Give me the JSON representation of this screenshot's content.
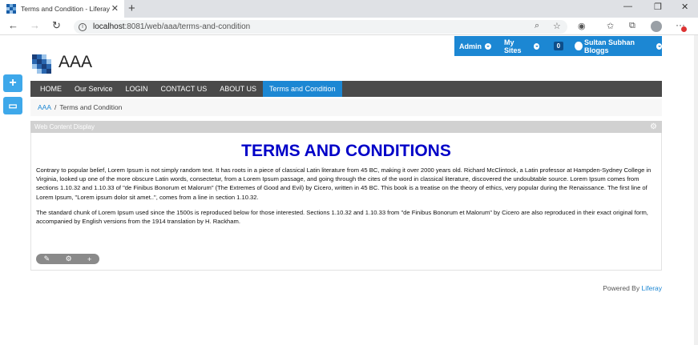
{
  "browser": {
    "tab_title": "Terms and Condition - Liferay",
    "url_host": "localhost",
    "url_path": ":8081/web/aaa/terms-and-condition"
  },
  "userbar": {
    "admin_label": "Admin",
    "mysites_label": "My Sites",
    "notif_count": "0",
    "user_name": "Sultan Subhan Bloggs"
  },
  "site": {
    "title": "AAA"
  },
  "nav": {
    "items": [
      {
        "label": "HOME"
      },
      {
        "label": "Our Service"
      },
      {
        "label": "LOGIN"
      },
      {
        "label": "CONTACT US"
      },
      {
        "label": "ABOUT US"
      },
      {
        "label": "Terms and Condition"
      }
    ]
  },
  "breadcrumb": {
    "root": "AAA",
    "separator": "/",
    "current": "Terms and Condition"
  },
  "portlet": {
    "title": "Web Content Display",
    "heading": "TERMS AND CONDITIONS",
    "para1": "Contrary to popular belief, Lorem Ipsum is not simply random text. It has roots in a piece of classical Latin literature from 45 BC, making it over 2000 years old. Richard McClintock, a Latin professor at Hampden-Sydney College in Virginia, looked up one of the more obscure Latin words, consectetur, from a Lorem Ipsum passage, and going through the cites of the word in classical literature, discovered the undoubtable source. Lorem Ipsum comes from sections 1.10.32 and 1.10.33 of \"de Finibus Bonorum et Malorum\" (The Extremes of Good and Evil) by Cicero, written in 45 BC. This book is a treatise on the theory of ethics, very popular during the Renaissance. The first line of Lorem Ipsum, \"Lorem ipsum dolor sit amet..\", comes from a line in section 1.10.32.",
    "para2": "The standard chunk of Lorem Ipsum used since the 1500s is reproduced below for those interested. Sections 1.10.32 and 1.10.33 from \"de Finibus Bonorum et Malorum\" by Cicero are also reproduced in their exact original form, accompanied by English versions from the 1914 translation by H. Rackham."
  },
  "footer": {
    "powered_prefix": "Powered By",
    "powered_link": "Liferay"
  },
  "colors": {
    "accent": "#1c87d3",
    "heading": "#0000c8",
    "navbar": "#4a4a4a"
  },
  "icons": {
    "tab_close": "close-icon",
    "new_tab": "plus-icon",
    "add": "add-icon",
    "preview": "monitor-icon",
    "edit": "pencil-icon",
    "config": "gear-icon"
  }
}
